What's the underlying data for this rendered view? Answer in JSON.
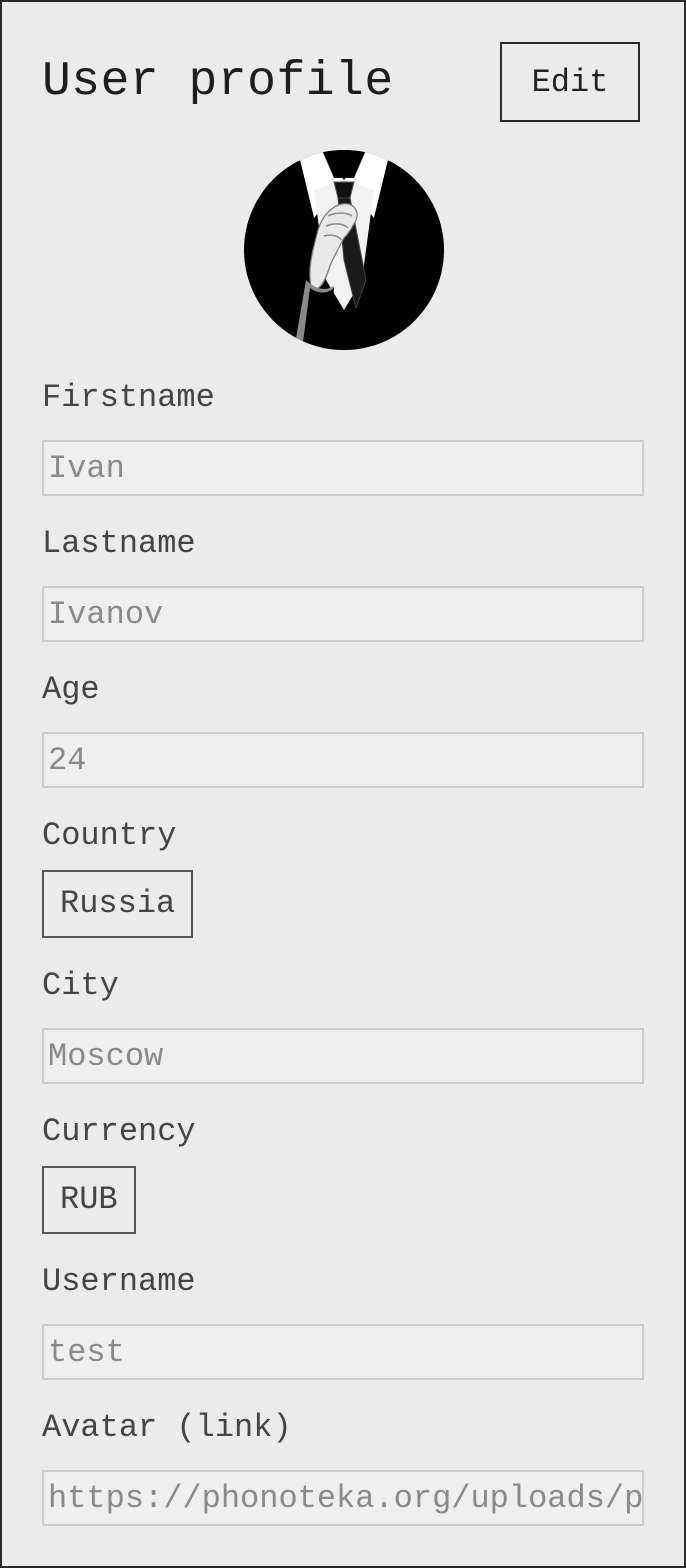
{
  "header": {
    "title": "User profile",
    "edit_label": "Edit"
  },
  "avatar": {
    "icon": "user-avatar-suit-icon"
  },
  "fields": {
    "firstname": {
      "label": "Firstname",
      "value": "Ivan"
    },
    "lastname": {
      "label": "Lastname",
      "value": "Ivanov"
    },
    "age": {
      "label": "Age",
      "value": "24"
    },
    "country": {
      "label": "Country",
      "value": "Russia"
    },
    "city": {
      "label": "City",
      "value": "Moscow"
    },
    "currency": {
      "label": "Currency",
      "value": "RUB"
    },
    "username": {
      "label": "Username",
      "value": "test"
    },
    "avatar_link": {
      "label": "Avatar (link)",
      "value": "https://phonoteka.org/uploads/p"
    }
  },
  "colors": {
    "background": "#ebebeb",
    "border": "#2a2a2a",
    "field_bg": "#efefef"
  }
}
